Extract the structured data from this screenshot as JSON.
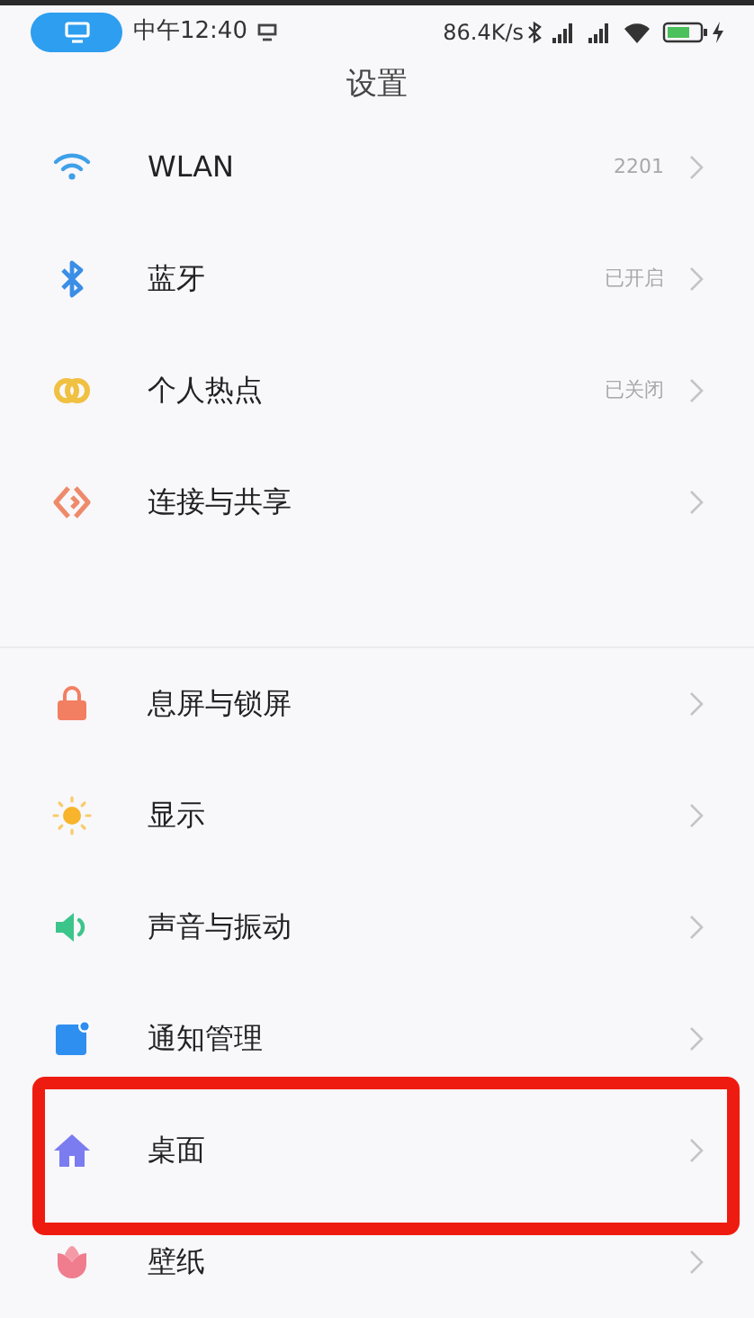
{
  "status_bar": {
    "time": "中午12:40",
    "speed": "86.4K/s"
  },
  "header": {
    "title": "设置"
  },
  "groups": [
    {
      "items": [
        {
          "label": "WLAN",
          "value": "2201",
          "highlighted": false
        },
        {
          "label": "蓝牙",
          "value": "已开启",
          "highlighted": false
        },
        {
          "label": "个人热点",
          "value": "已关闭",
          "highlighted": false
        },
        {
          "label": "连接与共享",
          "highlighted": false
        }
      ]
    },
    {
      "items": [
        {
          "label": "息屏与锁屏",
          "highlighted": false
        },
        {
          "label": "显示",
          "highlighted": false
        },
        {
          "label": "声音与振动",
          "highlighted": false
        },
        {
          "label": "通知管理",
          "highlighted": false
        },
        {
          "label": "桌面",
          "highlighted": true
        },
        {
          "label": "壁纸",
          "highlighted": false
        }
      ]
    }
  ]
}
